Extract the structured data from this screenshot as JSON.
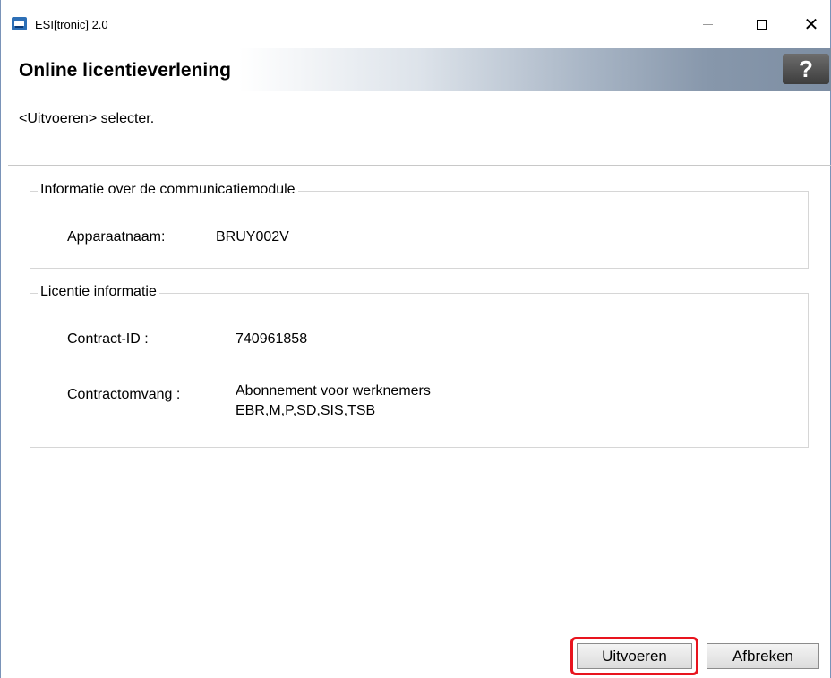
{
  "window": {
    "title": "ESI[tronic] 2.0",
    "icons": {
      "app": "app-icon",
      "minimize": "minimize-icon",
      "maximize": "maximize-icon",
      "close": "close-icon"
    }
  },
  "header": {
    "title": "Online licentieverlening",
    "help_label": "?"
  },
  "instruction": "<Uitvoeren> selecter.",
  "module_group": {
    "legend": "Informatie over de communicatiemodule",
    "device_label": "Apparaatnaam:",
    "device_value": "BRUY002V"
  },
  "license_group": {
    "legend": "Licentie informatie",
    "contract_id_label": "Contract-ID :",
    "contract_id_value": "740961858",
    "scope_label": "Contractomvang :",
    "scope_line1": "Abonnement voor werknemers",
    "scope_line2": "EBR,M,P,SD,SIS,TSB"
  },
  "footer": {
    "execute_label": "Uitvoeren",
    "cancel_label": "Afbreken"
  },
  "colors": {
    "highlight": "#e8141e",
    "accent": "#2d6fb6"
  }
}
